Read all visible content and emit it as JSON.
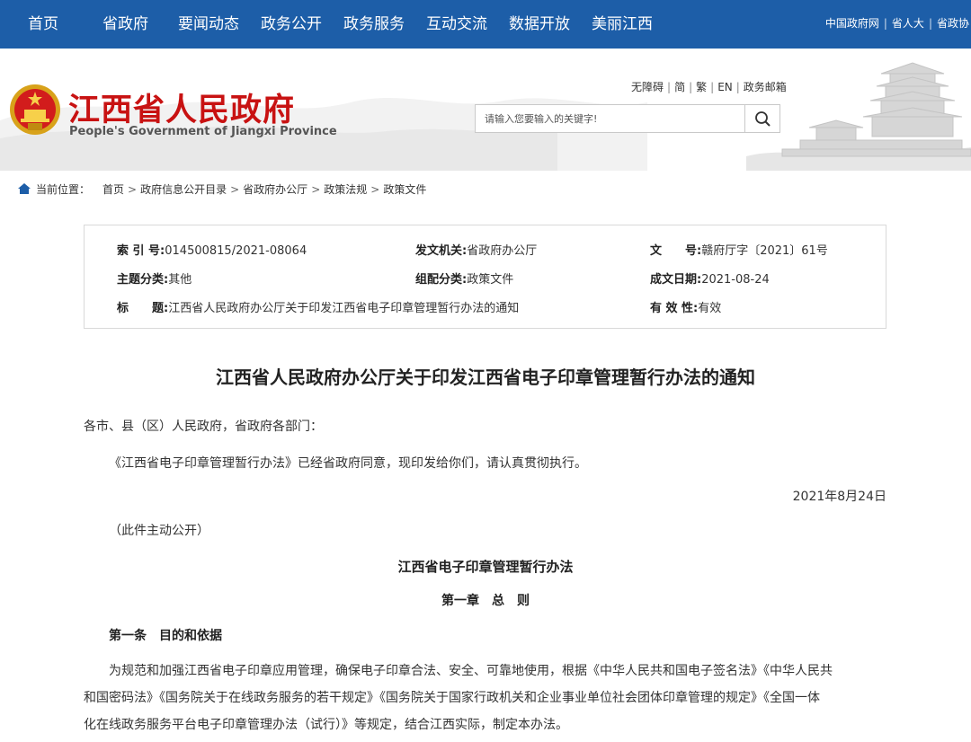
{
  "nav": {
    "items": [
      "首页",
      "省政府",
      "要闻动态",
      "政务公开",
      "政务服务",
      "互动交流",
      "数据开放",
      "美丽江西"
    ],
    "right_links": [
      "中国政府网",
      "省人大",
      "省政协"
    ],
    "bg_color": "#1d5ea8"
  },
  "header": {
    "title": "江西省人民政府",
    "subtitle": "People's Government of Jiangxi Province",
    "utility_links": [
      "无障碍",
      "简",
      "繁",
      "EN",
      "政务邮箱"
    ],
    "search_placeholder": "请输入您要输入的关键字!",
    "title_color": "#c81212"
  },
  "breadcrumb": {
    "label": "当前位置：",
    "items": [
      "首页",
      "政府信息公开目录",
      "省政府办公厅",
      "政策法规",
      "政策文件"
    ]
  },
  "info": {
    "index_label": "索 引 号:",
    "index_value": "014500815/2021-08064",
    "issuer_label": "发文机关:",
    "issuer_value": "省政府办公厅",
    "docno_label": "文　　号:",
    "docno_value": "赣府厅字〔2021〕61号",
    "topic_label": "主题分类:",
    "topic_value": "其他",
    "category_label": "组配分类:",
    "category_value": "政策文件",
    "date_label": "成文日期:",
    "date_value": "2021-08-24",
    "title_label": "标　　题:",
    "title_value": "江西省人民政府办公厅关于印发江西省电子印章管理暂行办法的通知",
    "validity_label": "有 效 性:",
    "validity_value": "有效"
  },
  "article": {
    "title": "江西省人民政府办公厅关于印发江西省电子印章管理暂行办法的通知",
    "salutation": "各市、县（区）人民政府，省政府各部门：",
    "body": "《江西省电子印章管理暂行办法》已经省政府同意，现印发给你们，请认真贯彻执行。",
    "date": "2021年8月24日",
    "disclosure": "（此件主动公开）",
    "subtitle": "江西省电子印章管理暂行办法",
    "chapter": "第一章　总　则",
    "article1_heading": "第一条　目的和依据",
    "article1_lines": [
      "为规范和加强江西省电子印章应用管理，确保电子印章合法、安全、可靠地使用，根据《中华人民共和国电子签名法》《中华人民共",
      "和国密码法》《国务院关于在线政务服务的若干规定》《国务院关于国家行政机关和企业事业单位社会团体印章管理的规定》《全国一体",
      "化在线政务服务平台电子印章管理办法（试行）》等规定，结合江西实际，制定本办法。"
    ]
  }
}
